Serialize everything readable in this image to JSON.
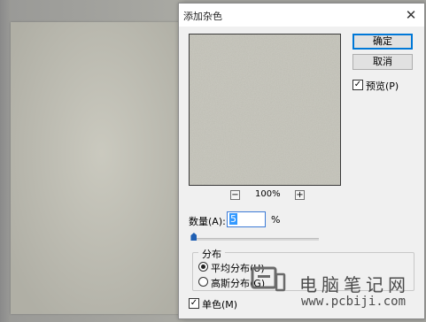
{
  "dialog": {
    "title": "添加杂色",
    "close_glyph": "✕",
    "ok_label": "确定",
    "cancel_label": "取消",
    "preview_label": "预览(P)",
    "preview_checked": true,
    "zoom_out_glyph": "−",
    "zoom_in_glyph": "+",
    "zoom_level": "100%",
    "amount_label": "数量(A):",
    "amount_value": "5",
    "amount_unit": "%",
    "amount_slider_fraction": 0.01,
    "distribution_label": "分布",
    "distribution_options": [
      {
        "label": "平均分布(U)",
        "selected": true
      },
      {
        "label": "高斯分布(G)",
        "selected": false
      }
    ],
    "monochrome_label": "单色(M)",
    "monochrome_checked": true,
    "check_glyph": "✓"
  },
  "watermark": {
    "text_cn": "电脑笔记网",
    "url": "www.pcbiji.com"
  },
  "colors": {
    "noise_base": "#c5c4b9",
    "accent": "#0078d7",
    "slider_thumb": "#1f5fb3"
  }
}
